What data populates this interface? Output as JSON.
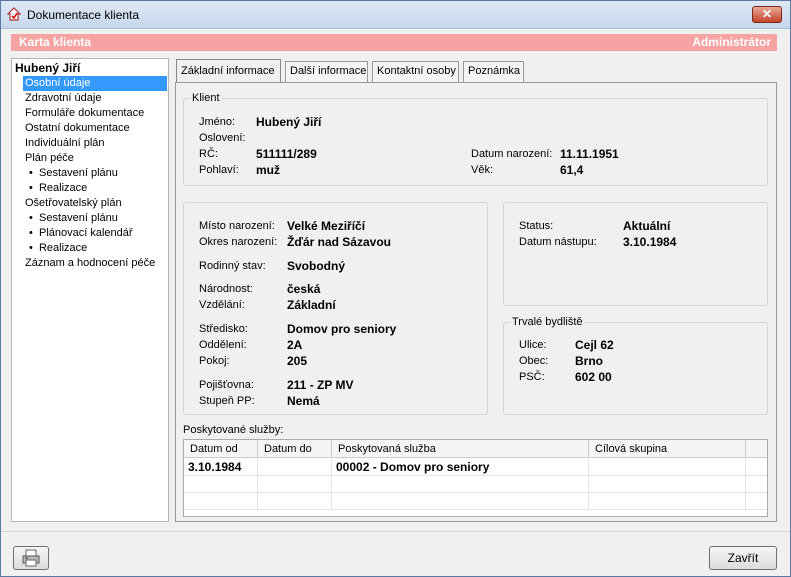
{
  "window": {
    "title": "Dokumentace klienta",
    "close_glyph": "✕"
  },
  "header": {
    "left": "Karta klienta",
    "right": "Administrátor"
  },
  "sidebar": {
    "items": [
      "Hubený Jiří",
      "Osobní údaje",
      "Zdravotní údaje",
      "Formuláře dokumentace",
      "Ostatní dokumentace",
      "Individuální plán",
      "Plán péče",
      "Sestavení plánu",
      "Realizace",
      "Ošetřovatelský plán",
      "Sestavení plánu",
      "Plánovací kalendář",
      "Realizace",
      "Záznam a hodnocení péče"
    ],
    "bullet": "•"
  },
  "tabs": [
    "Základní informace",
    "Další informace",
    "Kontaktní osoby",
    "Poznámka"
  ],
  "klient": {
    "title": "Klient",
    "jmeno_label": "Jméno:",
    "jmeno": "Hubený Jiří",
    "osloveni_label": "Oslovení:",
    "osloveni": "",
    "rc_label": "RČ:",
    "rc": "511111/289",
    "pohlavi_label": "Pohlaví:",
    "pohlavi": "muž",
    "narozeni_label": "Datum narození:",
    "narozeni": "11.11.1951",
    "vek_label": "Věk:",
    "vek": "61,4"
  },
  "detail": {
    "misto_label": "Místo narození:",
    "misto": "Velké Meziříčí",
    "okres_label": "Okres narození:",
    "okres": "Žďár nad Sázavou",
    "stav_label": "Rodinný stav:",
    "stav": "Svobodný",
    "narodnost_label": "Národnost:",
    "narodnost": "česká",
    "vzdelani_label": "Vzdělání:",
    "vzdelani": "Základní",
    "stredisko_label": "Středisko:",
    "stredisko": "Domov pro seniory",
    "oddeleni_label": "Oddělení:",
    "oddeleni": "2A",
    "pokoj_label": "Pokoj:",
    "pokoj": "205",
    "pojistovna_label": "Pojišťovna:",
    "pojistovna": "211 - ZP MV",
    "stupen_label": "Stupeň PP:",
    "stupen": "Nemá"
  },
  "status": {
    "status_label": "Status:",
    "status": "Aktuální",
    "nastup_label": "Datum nástupu:",
    "nastup": "3.10.1984"
  },
  "bydliste": {
    "title": "Trvalé bydliště",
    "ulice_label": "Ulice:",
    "ulice": "Cejl 62",
    "obec_label": "Obec:",
    "obec": "Brno",
    "psc_label": "PSČ:",
    "psc": "602 00"
  },
  "services": {
    "title": "Poskytované služby:",
    "columns": [
      "Datum od",
      "Datum do",
      "Poskytovaná služba",
      "Cílová skupina"
    ],
    "rows": [
      [
        "3.10.1984",
        "",
        "00002 - Domov pro seniory",
        ""
      ]
    ]
  },
  "footer": {
    "close_label": "Zavřít"
  }
}
